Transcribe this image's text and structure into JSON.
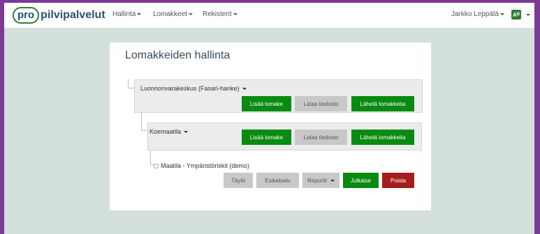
{
  "navbar": {
    "logo_pro": "pro",
    "logo_rest": "pilvipalvelut",
    "menus": [
      "Hallinta",
      "Lomakkeet",
      "Rekisterit"
    ],
    "user": "Jarkko Leppälä",
    "lang_icon": "language-flag-icon"
  },
  "page": {
    "title": "Lomakkeiden hallinta"
  },
  "tree": {
    "level1": {
      "label": "Luonnonvarakeskus (Fasari-hanke)",
      "buttons": [
        "Lisää lomake",
        "Lataa tiedosto",
        "Lähetä lomakkeita"
      ]
    },
    "level2": {
      "label": "Koemaatila",
      "buttons": [
        "Lisää lomake",
        "Lataa tiedosto",
        "Lähetä lomakkeita"
      ]
    },
    "leaf": {
      "label": "Maatila - Ympäristöriskit (demo)",
      "buttons": [
        "Täytä",
        "Esikatselu",
        "Reportit",
        "Julkaise",
        "Poista"
      ]
    }
  },
  "colors": {
    "frame": "#7b3a96",
    "background": "#d3e0dd",
    "green": "#088b10",
    "red": "#a51c1c",
    "gray": "#c8c8c8"
  }
}
